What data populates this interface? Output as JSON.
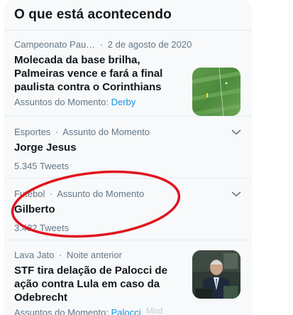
{
  "panel": {
    "title": "O que está acontecendo"
  },
  "trends": [
    {
      "category": "Campeonato Pau…",
      "separator": "·",
      "date": "2 de agosto de 2020",
      "headline": "Molecada da base brilha, Palmeiras vence e fará a final paulista contra o Corinthians",
      "topics_label": "Assuntos do Momento:",
      "topics_link": "Derby",
      "thumbnail_icon": "soccer-field-thumbnail"
    },
    {
      "category": "Esportes",
      "separator": "·",
      "context": "Assunto do Momento",
      "headline": "Jorge Jesus",
      "tweets": "5.345 Tweets",
      "menu_icon": "chevron-down-icon"
    },
    {
      "category": "Futebol",
      "separator": "·",
      "context": "Assunto do Momento",
      "headline": "Gilberto",
      "tweets": "3.482 Tweets",
      "menu_icon": "chevron-down-icon"
    },
    {
      "category": "Lava Jato",
      "separator": "·",
      "context": "Noite anterior",
      "headline": "STF tira delação de Palocci de ação contra Lula em caso da Odebrecht",
      "topics_label": "Assuntos do Momento:",
      "topics_link": "Palocci",
      "thumbnail_icon": "news-anchor-thumbnail"
    }
  ],
  "watermark": "Mird",
  "colors": {
    "accent": "#1b95e0",
    "text_primary": "#14171a",
    "text_secondary": "#657786",
    "panel_bg": "#f7f9fa",
    "annotation": "#e0141e"
  }
}
